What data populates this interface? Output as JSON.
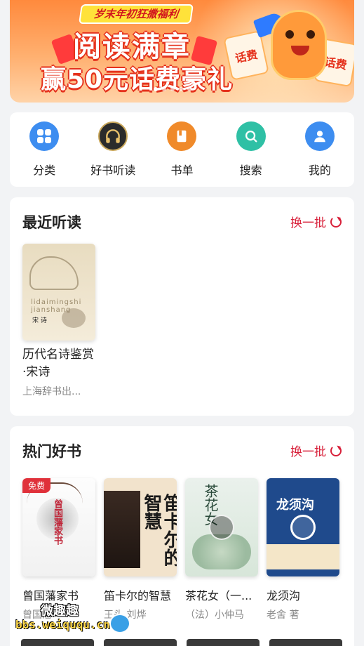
{
  "banner": {
    "tag": "岁末年初狂撒福利",
    "line1": "阅读满章",
    "line2": "赢50元话费豪礼",
    "ticket_left": "话费",
    "ticket_right": "话费"
  },
  "quick_nav": [
    {
      "label": "分类",
      "icon": "grid-icon",
      "color": "#3d8df0"
    },
    {
      "label": "好书听读",
      "icon": "headphones-icon",
      "color": "#2b2b2b"
    },
    {
      "label": "书单",
      "icon": "book-icon",
      "color": "#f08a2a"
    },
    {
      "label": "搜索",
      "icon": "search-icon",
      "color": "#2fc0a5"
    },
    {
      "label": "我的",
      "icon": "user-icon",
      "color": "#3d8df0"
    }
  ],
  "recent": {
    "title": "最近听读",
    "refresh": "换一批",
    "books": [
      {
        "title": "历代名诗鉴赏·宋诗",
        "publisher": "上海辞书出...",
        "cover_mark": "lidaimingshi jianshang",
        "cover_text": "宋 诗"
      }
    ]
  },
  "hot": {
    "title": "热门好书",
    "refresh": "换一批",
    "books": [
      {
        "title": "曾国藩家书",
        "author": "曾国藩",
        "badge": "免费",
        "cover_text": "曾国藩家书"
      },
      {
        "title": "笛卡尔的智慧",
        "author": "王头 刘烨",
        "cover_text": "笛卡尔的智慧"
      },
      {
        "title": "茶花女（一...",
        "author": "（法）小仲马",
        "cover_text": "茶花女"
      },
      {
        "title": "龙须沟",
        "author": "老舍 著",
        "cover_text": "龙须沟"
      }
    ]
  },
  "watermark": {
    "line1": "微趣趣",
    "line2": "bbs.weiququ.cn"
  },
  "colors": {
    "accent_red": "#d8203a",
    "background": "#f2f3f5"
  }
}
